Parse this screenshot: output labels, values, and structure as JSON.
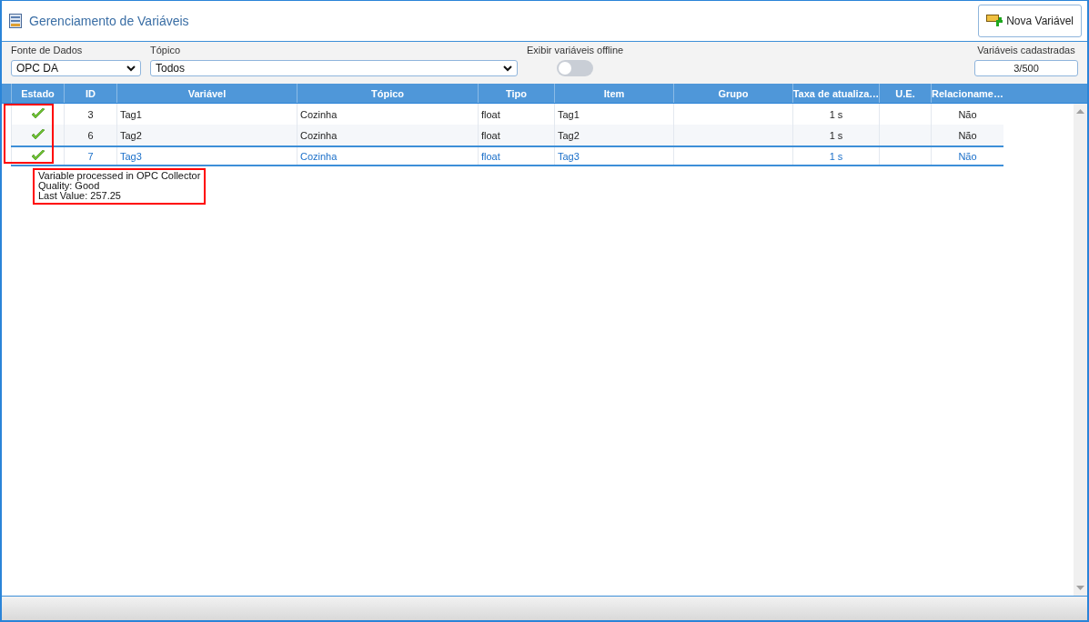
{
  "window": {
    "title": "Gerenciamento de Variáveis"
  },
  "new_button": {
    "label": "Nova Variável"
  },
  "filters": {
    "data_source": {
      "label": "Fonte de Dados",
      "value": "OPC DA"
    },
    "topic": {
      "label": "Tópico",
      "value": "Todos"
    },
    "offline": {
      "label": "Exibir variáveis offline",
      "on": false
    },
    "count": {
      "label": "Variáveis cadastradas",
      "value": "3/500"
    }
  },
  "table": {
    "columns": [
      "Estado",
      "ID",
      "Variável",
      "Tópico",
      "Tipo",
      "Item",
      "Grupo",
      "Taxa de atualiza…",
      "U.E.",
      "Relacioname…"
    ],
    "rows": [
      {
        "ok": true,
        "selected": false,
        "cells": [
          "",
          "3",
          "Tag1",
          "Cozinha",
          "float",
          "Tag1",
          "",
          "1 s",
          "",
          "Não"
        ]
      },
      {
        "ok": true,
        "selected": false,
        "cells": [
          "",
          "6",
          "Tag2",
          "Cozinha",
          "float",
          "Tag2",
          "",
          "1 s",
          "",
          "Não"
        ]
      },
      {
        "ok": true,
        "selected": true,
        "cells": [
          "",
          "7",
          "Tag3",
          "Cozinha",
          "float",
          "Tag3",
          "",
          "1 s",
          "",
          "Não"
        ]
      }
    ]
  },
  "tooltip": {
    "lines": [
      "Variable processed in OPC Collector",
      "Quality: Good",
      "Last Value: 257.25"
    ]
  }
}
